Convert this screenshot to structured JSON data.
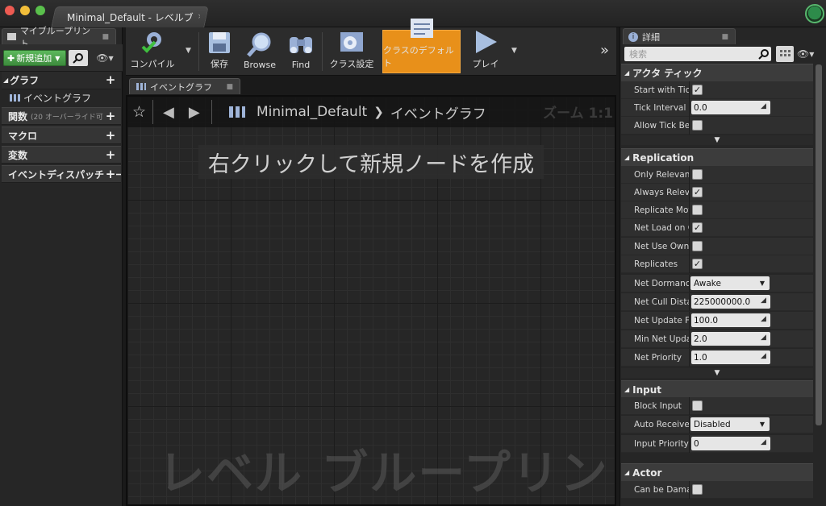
{
  "window": {
    "tab_title": "Minimal_Default - レベルブ"
  },
  "colors": {
    "accent_orange": "#e8901a",
    "green_button": "#4aa84a",
    "panel_bg": "#262626"
  },
  "left_panel": {
    "tab_label": "マイブループリント",
    "add_new_label": "新規追加",
    "categories": {
      "graph": "グラフ",
      "event_graph": "イベントグラフ",
      "functions": "関数",
      "functions_sub": "(20 オーバーライド可",
      "macros": "マクロ",
      "variables": "変数",
      "event_dispatchers": "イベントディスパッチャー"
    }
  },
  "toolbar": {
    "compile": "コンパイル",
    "save": "保存",
    "browse": "Browse",
    "find": "Find",
    "class_settings": "クラス設定",
    "class_defaults": "クラスのデフォルト",
    "play": "プレイ"
  },
  "graph": {
    "tab_label": "イベントグラフ",
    "breadcrumb_root": "Minimal_Default",
    "breadcrumb_current": "イベントグラフ",
    "zoom": "ズーム 1:1",
    "hint": "右クリックして新規ノードを作成",
    "watermark": "レベル ブループリント"
  },
  "details": {
    "tab_label": "詳細",
    "search_placeholder": "検索",
    "sections": {
      "actor_tick": "アクタ ティック",
      "replication": "Replication",
      "input": "Input",
      "actor": "Actor"
    },
    "props": {
      "start_with_tick": {
        "label": "Start with Tick",
        "checked": true
      },
      "tick_interval": {
        "label": "Tick Interval (",
        "value": "0.0"
      },
      "allow_tick_before": {
        "label": "Allow Tick Bef",
        "checked": false
      },
      "only_relevant": {
        "label": "Only Relevant",
        "checked": false
      },
      "always_relevant": {
        "label": "Always Releva",
        "checked": true
      },
      "replicate_movement": {
        "label": "Replicate Mov",
        "checked": false
      },
      "net_load_on_client": {
        "label": "Net Load on C",
        "checked": true
      },
      "net_use_owner": {
        "label": "Net Use Owne",
        "checked": false
      },
      "replicates": {
        "label": "Replicates",
        "checked": true
      },
      "net_dormancy": {
        "label": "Net Dormancy",
        "value": "Awake"
      },
      "net_cull_distance": {
        "label": "Net Cull Distar",
        "value": "225000000.0"
      },
      "net_update_freq": {
        "label": "Net Update Fre",
        "value": "100.0"
      },
      "min_net_update": {
        "label": "Min Net Updat",
        "value": "2.0"
      },
      "net_priority": {
        "label": "Net Priority",
        "value": "1.0"
      },
      "block_input": {
        "label": "Block Input",
        "checked": false
      },
      "auto_receive_input": {
        "label": "Auto Receive I",
        "value": "Disabled"
      },
      "input_priority": {
        "label": "Input Priority",
        "value": "0"
      },
      "can_be_damaged": {
        "label": "Can be Damag",
        "checked": false
      }
    }
  }
}
